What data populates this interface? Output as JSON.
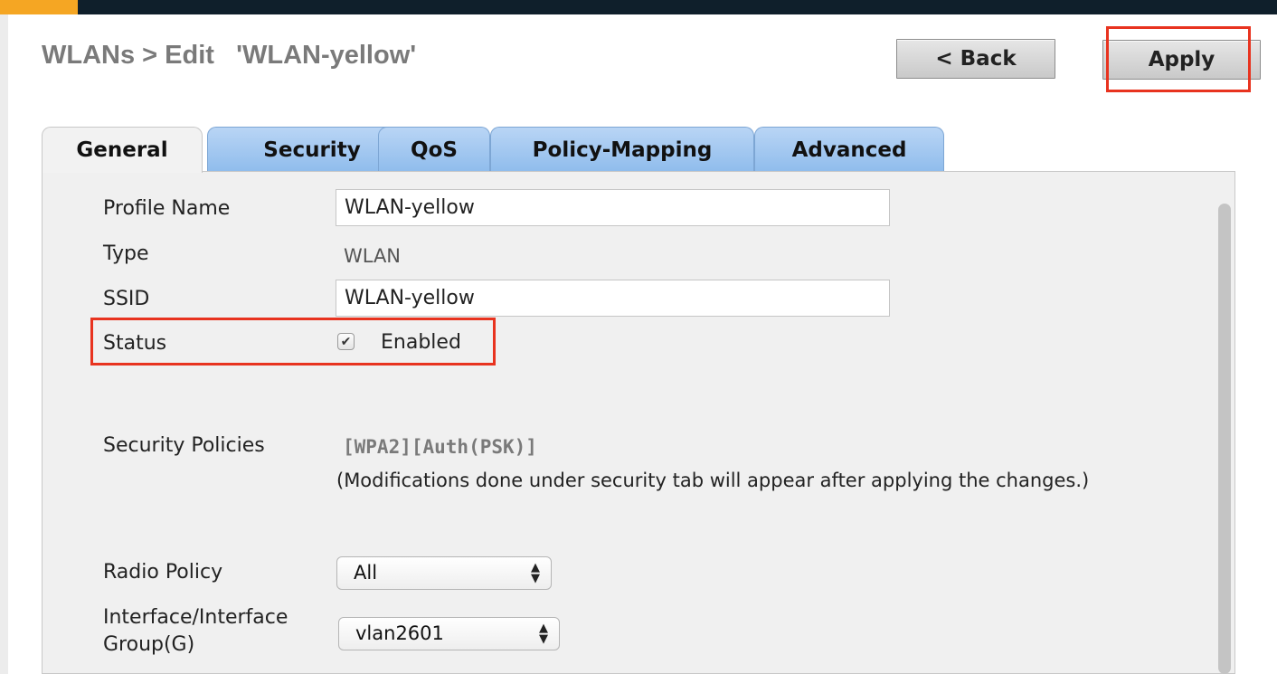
{
  "header": {
    "title": "WLANs > Edit   'WLAN-yellow'",
    "back_label": "< Back",
    "apply_label": "Apply"
  },
  "tabs": [
    {
      "label": "General",
      "active": true
    },
    {
      "label": "Security",
      "active": false
    },
    {
      "label": "QoS",
      "active": false
    },
    {
      "label": "Policy-Mapping",
      "active": false
    },
    {
      "label": "Advanced",
      "active": false
    }
  ],
  "form": {
    "profile_name_label": "Profile Name",
    "profile_name_value": "WLAN-yellow",
    "type_label": "Type",
    "type_value": "WLAN",
    "ssid_label": "SSID",
    "ssid_value": "WLAN-yellow",
    "status_label": "Status",
    "status_checked": true,
    "status_value": "Enabled",
    "security_policies_label": "Security Policies",
    "security_policies_value": "[WPA2][Auth(PSK)]",
    "security_note": "(Modifications done under security tab will appear after applying the changes.)",
    "radio_policy_label": "Radio Policy",
    "radio_policy_value": "All",
    "interface_label_line1": "Interface/Interface",
    "interface_label_line2": "Group(G)",
    "interface_value": "vlan2601"
  },
  "colors": {
    "highlight": "#e8331f",
    "tab_blue": "#8fbcec",
    "topbar": "#0f1f2b",
    "topbar_accent": "#f5a623"
  },
  "icons": {
    "checkbox": "checkmark-icon",
    "select_arrows": "updown-arrows-icon"
  }
}
